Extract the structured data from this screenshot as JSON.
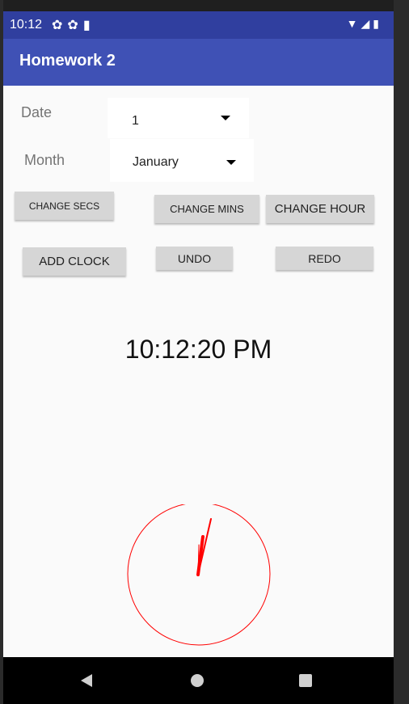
{
  "status_bar": {
    "time": "10:12",
    "left_icons": [
      "gear-icon",
      "gear-icon",
      "sd-card-icon"
    ],
    "right_icons": [
      "wifi-icon",
      "signal-icon",
      "battery-icon"
    ]
  },
  "app_bar": {
    "title": "Homework 2",
    "color": "#3f51b5"
  },
  "form": {
    "date_label": "Date",
    "date_value": "1",
    "month_label": "Month",
    "month_value": "January"
  },
  "buttons": {
    "change_secs": "CHANGE SECS",
    "change_mins": "CHANGE MINS",
    "change_hour": "CHANGE HOUR",
    "add_clock": "ADD CLOCK",
    "undo": "UNDO",
    "redo": "REDO"
  },
  "clock": {
    "time_text": "10:12:20 PM",
    "face_color": "#ff0000",
    "hand_color": "#ff0000"
  },
  "nav_bar": {
    "icons": [
      "back-icon",
      "home-icon",
      "recents-icon"
    ]
  }
}
